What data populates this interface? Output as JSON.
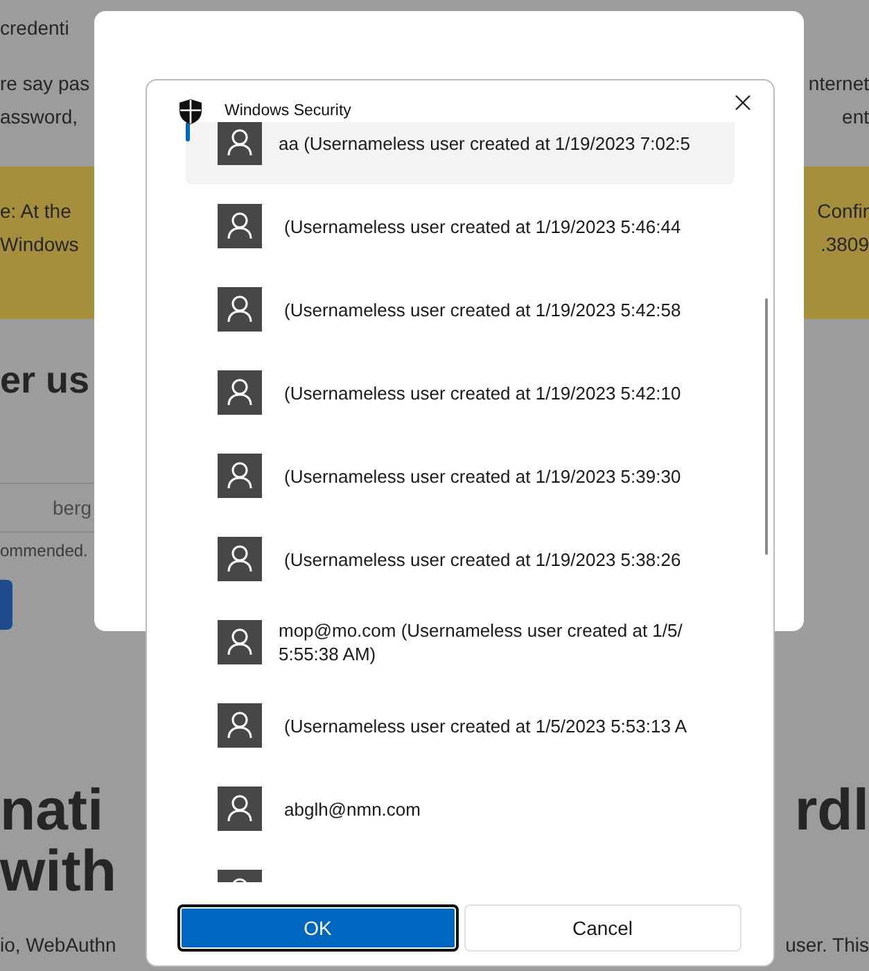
{
  "background_page": {
    "lines_top": [
      {
        "left": "credenti"
      },
      {
        "left": "re say pas",
        "right": "nternet"
      },
      {
        "left": "assword,",
        "right": "ent"
      }
    ],
    "note": [
      {
        "left": "e: At the",
        "right": "Confir"
      },
      {
        "left": "Windows",
        "right": ".3809"
      }
    ],
    "heading": "er us",
    "field": {
      "placeholder": "berg"
    },
    "hint": "ommended.",
    "title_lines": [
      {
        "left": "nati",
        "right": "rdl"
      },
      {
        "left": "with"
      }
    ],
    "text_bottom": {
      "left": "io, WebAuthn",
      "right": "user. This"
    }
  },
  "security_dialog": {
    "title": "Windows Security",
    "accounts": [
      {
        "lines": [
          "aa (Usernameless user created at 1/19/2023 7:02:5"
        ],
        "selected": true
      },
      {
        "lines": [
          "(Usernameless user created at 1/19/2023 5:46:44"
        ],
        "selected": false
      },
      {
        "lines": [
          "(Usernameless user created at 1/19/2023 5:42:58"
        ],
        "selected": false
      },
      {
        "lines": [
          "(Usernameless user created at 1/19/2023 5:42:10"
        ],
        "selected": false
      },
      {
        "lines": [
          "(Usernameless user created at 1/19/2023 5:39:30"
        ],
        "selected": false
      },
      {
        "lines": [
          "(Usernameless user created at 1/19/2023 5:38:26"
        ],
        "selected": false
      },
      {
        "lines": [
          "mop@mo.com (Usernameless user created at 1/5/",
          "5:55:38 AM)"
        ],
        "selected": false
      },
      {
        "lines": [
          "(Usernameless user created at 1/5/2023 5:53:13 A"
        ],
        "selected": false
      },
      {
        "lines": [
          "abglh@nmn.com"
        ],
        "selected": false
      }
    ],
    "buttons": [
      {
        "label": "OK",
        "kind": "primary"
      },
      {
        "label": "Cancel",
        "kind": "secondary"
      }
    ]
  }
}
